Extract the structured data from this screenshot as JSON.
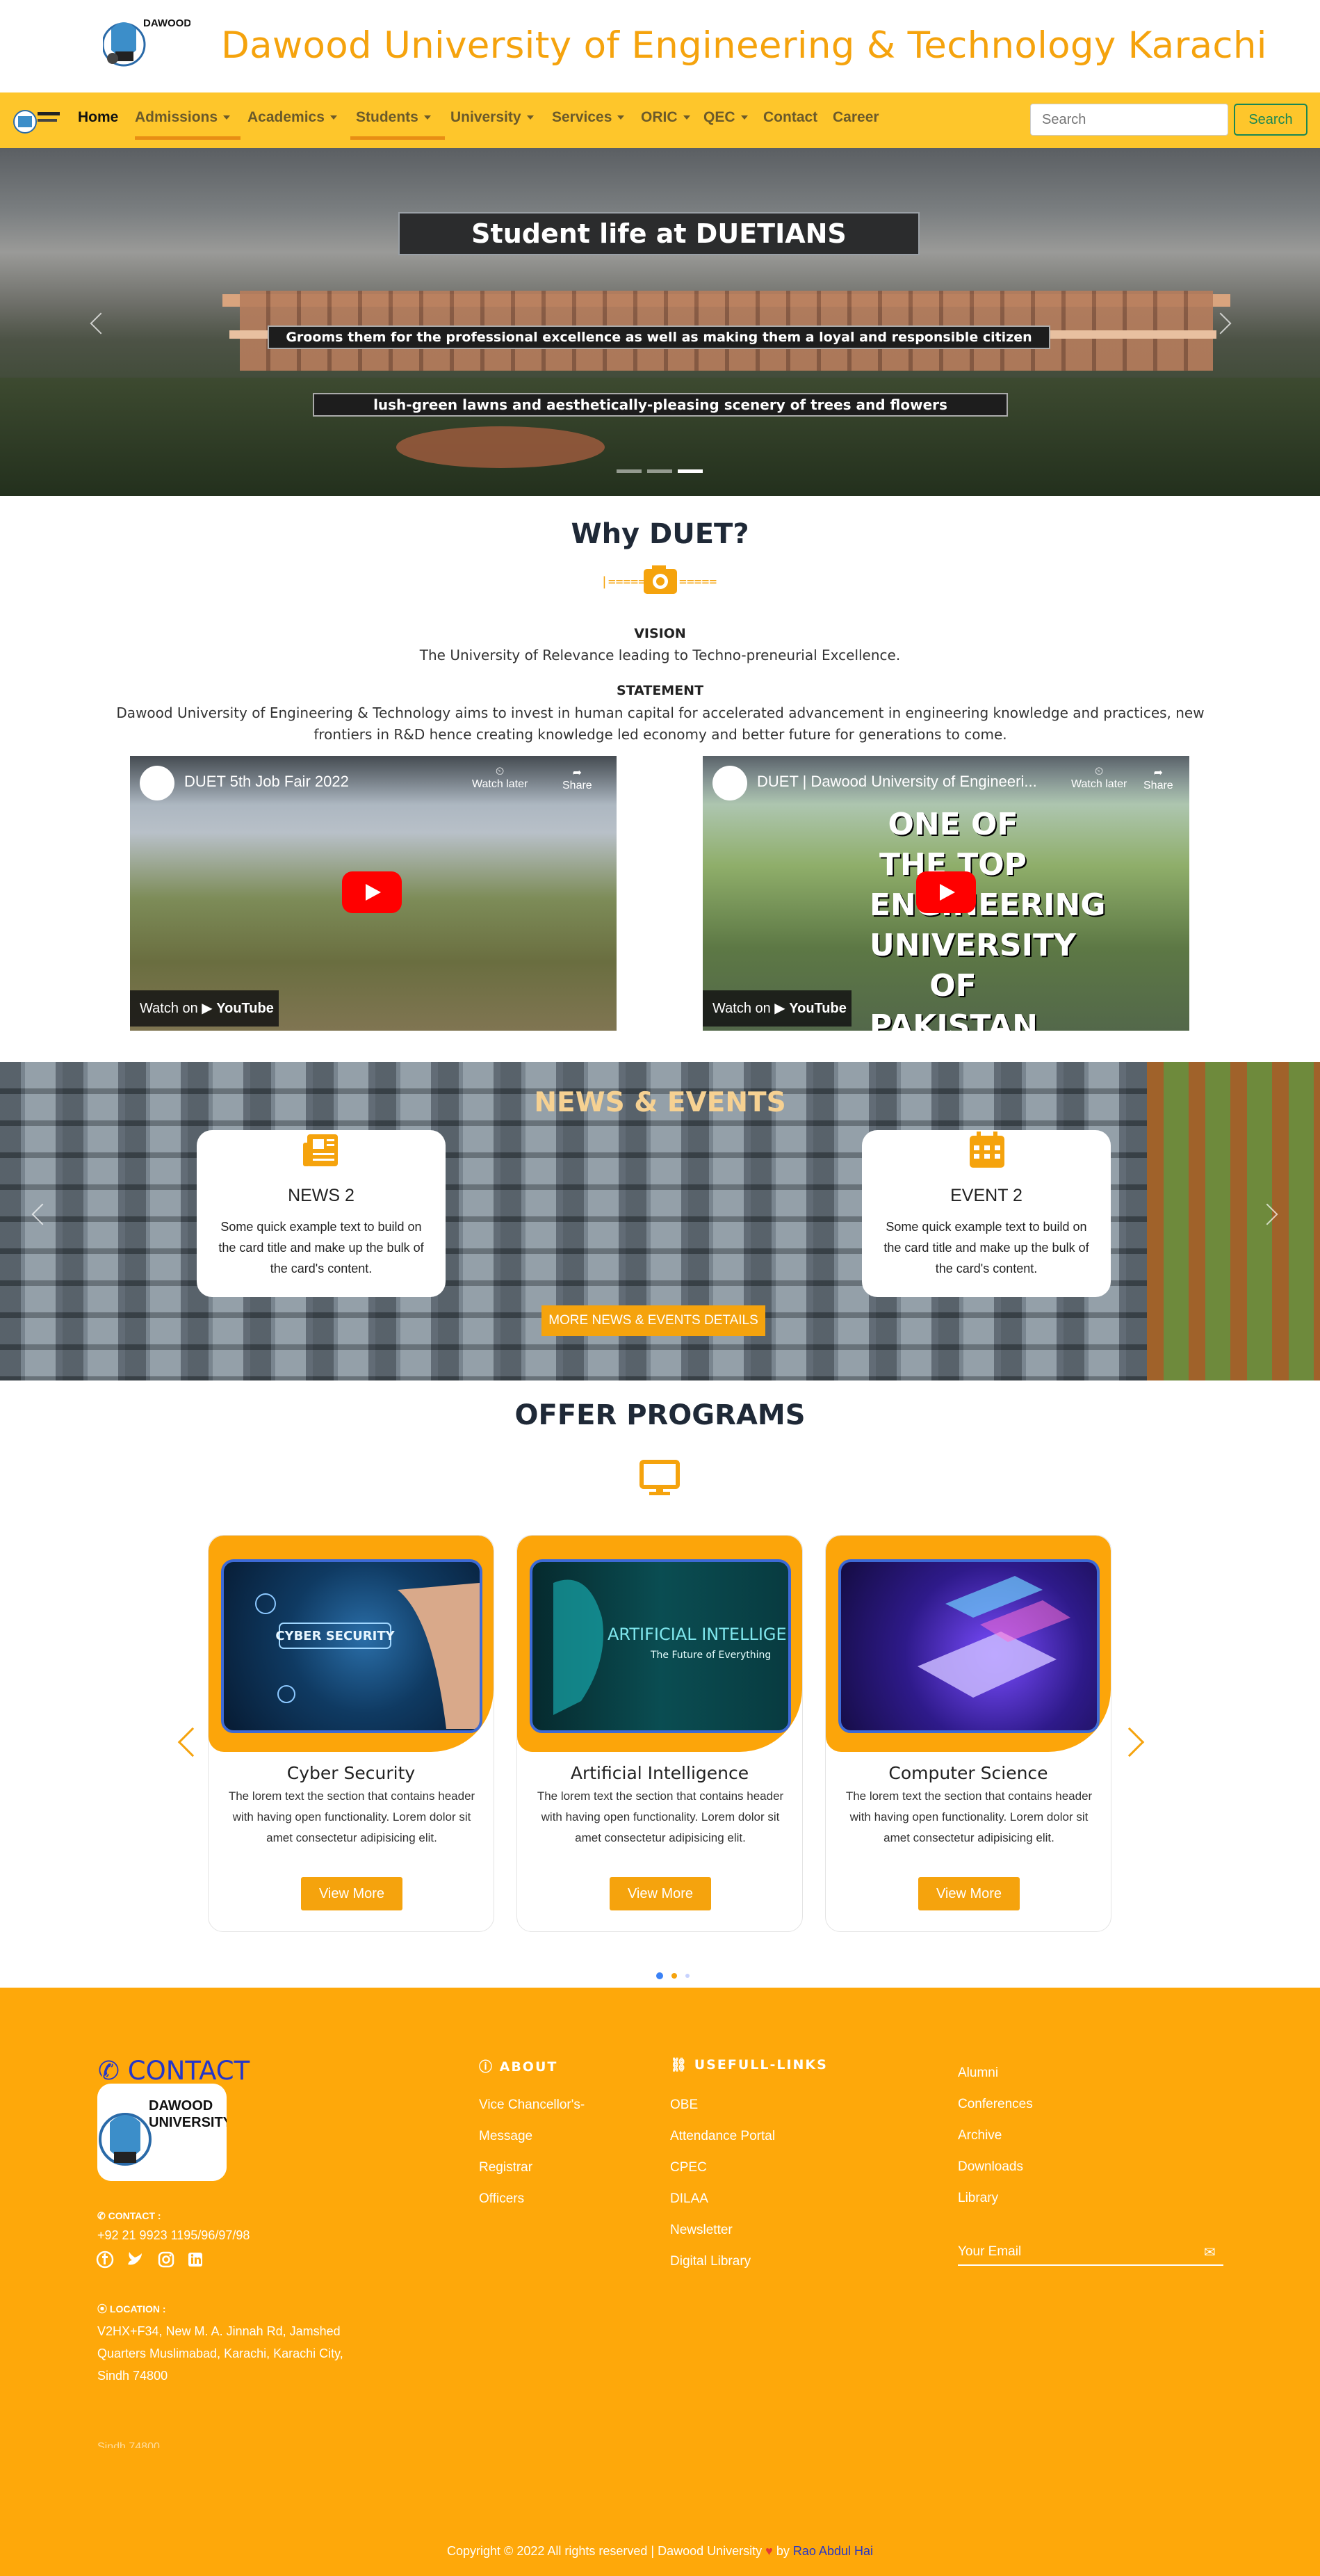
{
  "header": {
    "title": "Dawood University of Engineering & Technology Karachi",
    "logo_text": "DAWOOD UNIVERSITY"
  },
  "nav": {
    "items": [
      {
        "label": "Home",
        "dropdown": false
      },
      {
        "label": "Admissions",
        "dropdown": true
      },
      {
        "label": "Academics",
        "dropdown": true
      },
      {
        "label": "Students",
        "dropdown": true
      },
      {
        "label": "University",
        "dropdown": true
      },
      {
        "label": "Services",
        "dropdown": true
      },
      {
        "label": "ORIC",
        "dropdown": true
      },
      {
        "label": "QEC",
        "dropdown": true
      },
      {
        "label": "Contact",
        "dropdown": false
      },
      {
        "label": "Career",
        "dropdown": false
      }
    ],
    "search_placeholder": "Search",
    "search_button": "Search"
  },
  "hero": {
    "title": "Student life at DUETIANS",
    "caption1": "Grooms them for the professional excellence as well as making them a loyal and responsible citizen",
    "caption2": "lush-green lawns and aesthetically-pleasing scenery of trees and flowers",
    "active_slide": 3
  },
  "why": {
    "title": "Why DUET?",
    "vision_head": "VISION",
    "vision_text": "The University of Relevance leading to Techno-preneurial Excellence.",
    "statement_head": "STATEMENT",
    "statement_text": "Dawood University of Engineering & Technology aims to invest in human capital for accelerated advancement in engineering knowledge and practices, new frontiers in R&D hence creating knowledge led economy and better future for generations to come."
  },
  "videos": [
    {
      "title": "DUET 5th Job Fair 2022",
      "watch": "Watch on",
      "brand": "YouTube",
      "watch_later": "Watch later",
      "share": "Share"
    },
    {
      "title": "DUET | Dawood University of Engineeri...",
      "watch": "Watch on",
      "brand": "YouTube",
      "watch_later": "Watch later",
      "share": "Share",
      "overlay": "ONE OF THE TOP ENGINEERING UNIVERSITY OF PAKISTAN"
    }
  ],
  "news": {
    "title": "NEWS & EVENTS",
    "cards": [
      {
        "title": "NEWS 2",
        "body": "Some quick example text to build on the card title and make up the bulk of the card's content.",
        "icon": "newspaper-icon"
      },
      {
        "title": "EVENT 2",
        "body": "Some quick example text to build on the card title and make up the bulk of the card's content.",
        "icon": "calendar-icon"
      }
    ],
    "button": "MORE NEWS & EVENTS DETAILS"
  },
  "programs": {
    "title": "OFFER PROGRAMS",
    "items": [
      {
        "title": "Cyber Security",
        "desc": "The lorem text the section that contains header with having open functionality. Lorem dolor sit amet consectetur adipisicing elit.",
        "button": "View More",
        "image_text": "CYBER SECURITY"
      },
      {
        "title": "Artificial Intelligence",
        "desc": "The lorem text the section that contains header with having open functionality. Lorem dolor sit amet consectetur adipisicing elit.",
        "button": "View More",
        "image_text": "ARTIFICIAL INTELLIGEN",
        "image_sub": "The Future of Everything"
      },
      {
        "title": "Computer Science",
        "desc": "The lorem text the section that contains header with having open functionality. Lorem dolor sit amet consectetur adipisicing elit.",
        "button": "View More"
      }
    ],
    "active_dot": 1
  },
  "footer": {
    "contact_head": "CONTACT",
    "phone_head": "CONTACT :",
    "phone": "+92 21 9923 1195/96/97/98",
    "location_head": "LOCATION :",
    "address": "V2HX+F34, New M. A. Jinnah Rd, Jamshed Quarters Muslimabad, Karachi, Karachi City, Sindh 74800",
    "address_ghost": "Sindh 74800",
    "about_head": "ABOUT",
    "about_links": [
      "Vice Chancellor's-",
      "Message",
      "Registrar",
      "Officers"
    ],
    "useful_head": "USEFULL-LINKS",
    "useful_links": [
      "OBE",
      "Attendance Portal",
      "CPEC",
      "DILAA",
      "Newsletter",
      "Digital Library"
    ],
    "extra_links": [
      "Alumni",
      "Conferences",
      "Archive",
      "Downloads",
      "Library"
    ],
    "email_placeholder": "Your Email",
    "copyright": "Copyright © 2022 All rights reserved | Dawood University",
    "by": "by",
    "author": "Rao Abdul Hai"
  },
  "colors": {
    "brand_orange": "#f5a30d",
    "nav_yellow": "#fec62b",
    "footer_orange": "#fea80a",
    "search_green": "#198754",
    "contact_blue": "#2436c9"
  }
}
